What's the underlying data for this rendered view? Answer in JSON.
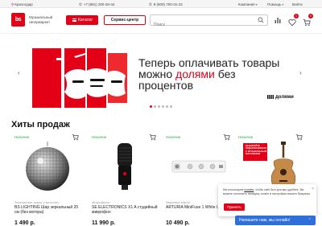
{
  "topbar": {
    "location": "Краснодар",
    "phone1": "+7 (861) 200-26-34",
    "phone2": "8 (800) 700-31-22",
    "menu": [
      {
        "label": "Компания"
      },
      {
        "label": "Помощь"
      },
      {
        "label": "Войти"
      }
    ]
  },
  "header": {
    "logo_text": "bs",
    "tagline": "Музыкальный гипермаркет",
    "catalog_label": "Каталог",
    "service_label": "Сервис-центр",
    "search_placeholder": "Поиск",
    "favorites_count": "1",
    "cart_count": "0"
  },
  "banner": {
    "line1": "Теперь оплачивать товары",
    "line2_prefix": "можно ",
    "line2_highlight": "долями",
    "line2_suffix": " без",
    "line3": "процентов",
    "dolyami_logo": "долями",
    "slides_total": 6,
    "active_slide": 1
  },
  "section": {
    "title": "Хиты продаж"
  },
  "products": [
    {
      "stock": "Наличие",
      "category": "Зеркальные шары и местеры",
      "name": "BS LIGHTING Шар зеркальный 20 см (без мотора)",
      "price": "1 490 р."
    },
    {
      "stock": "Наличие",
      "category": "Микрофоны",
      "name": "SE ELECTRONICS X1 A студийный микрофон",
      "price": "11 990 р."
    },
    {
      "stock": "Наличие",
      "category": "Звуковые карты",
      "name": "ARTURIA MiniFuse 1 White USB",
      "price": "10 490 р."
    },
    {
      "stock": "Наличие",
      "category": "",
      "name": "",
      "price": "",
      "sign_text": "ВЫБИРАЙТЕ ПОДАРКИ ВМЕСТЕ С МУЗЫКАЛЬНЫМ МАГАЗИНОМ"
    }
  ],
  "cookie": {
    "text_before": "Мы используем ",
    "link": "cookies",
    "text_after": ", чтобы сайт был для вас удобнее. Вы можете отключить передачу cookie в настройках вашего браузера",
    "button": "Принять"
  },
  "chat": {
    "label": "Напишите нам, мы онлайн!"
  },
  "colors": {
    "brand_red": "#e30016",
    "stock_green": "#2ea84a",
    "chat_blue": "#2f6fda"
  }
}
